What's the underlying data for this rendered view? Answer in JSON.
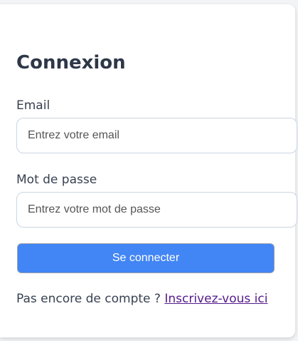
{
  "login": {
    "title": "Connexion",
    "email_label": "Email",
    "email_placeholder": "Entrez votre email",
    "email_value": "",
    "password_label": "Mot de passe",
    "password_placeholder": "Entrez votre mot de passe",
    "password_value": "",
    "submit_label": "Se connecter",
    "signup_prompt": "Pas encore de compte ? ",
    "signup_link": "Inscrivez-vous ici"
  },
  "colors": {
    "primary_button": "#4285f4",
    "heading": "#2d3748",
    "visited_link": "#551a8b"
  }
}
